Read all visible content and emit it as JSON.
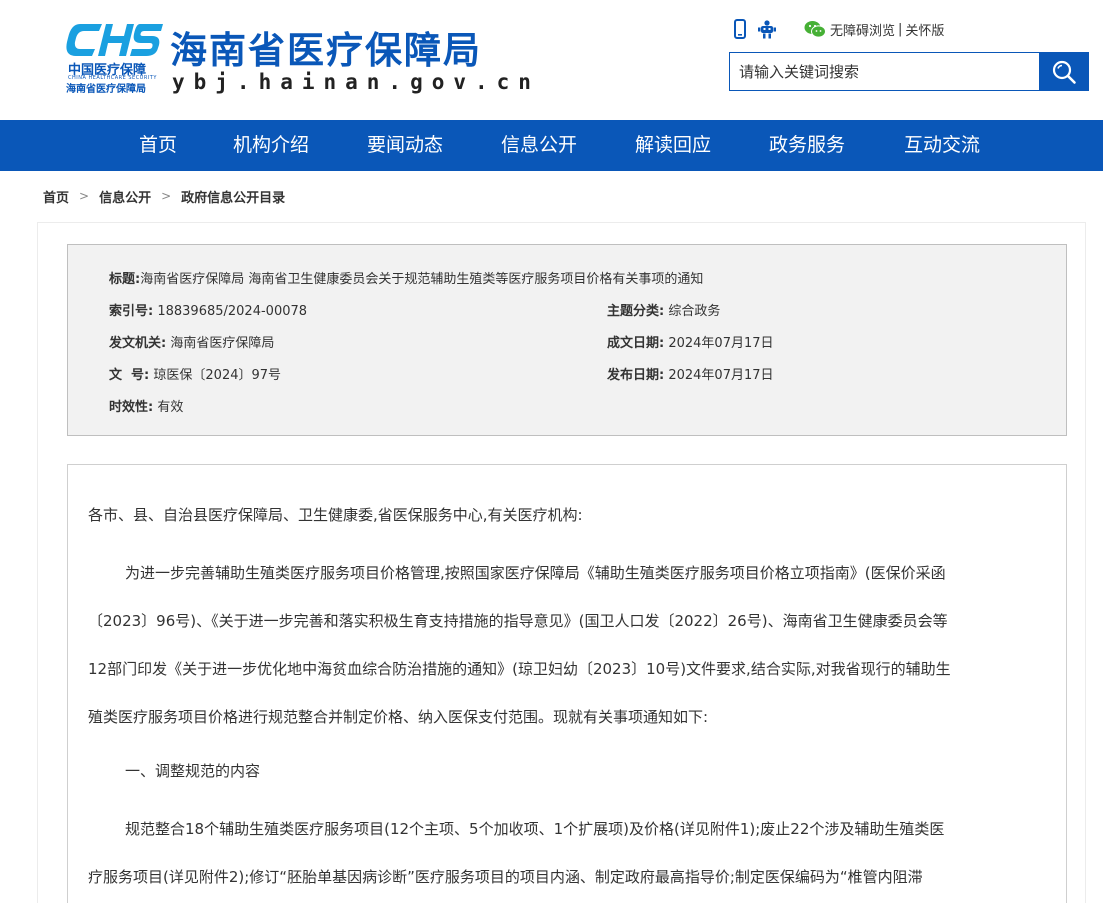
{
  "site": {
    "logo_abbr": "CHS",
    "logo_org_cn": "中国医疗保障",
    "logo_org_en": "CHINA HEALTHCARE SECURITY",
    "logo_org_local": "海南省医疗保障局",
    "title": "海南省医疗保障局",
    "domain": "ybj.hainan.gov.cn"
  },
  "topbar": {
    "accessible": "无障碍浏览",
    "separator": "|",
    "care_mode": "关怀版"
  },
  "search": {
    "placeholder": "请输入关键词搜索"
  },
  "nav": {
    "items": [
      "首页",
      "机构介绍",
      "要闻动态",
      "信息公开",
      "解读回应",
      "政务服务",
      "互动交流"
    ]
  },
  "breadcrumb": {
    "items": [
      "首页",
      "信息公开",
      "政府信息公开目录"
    ],
    "separator": ">"
  },
  "info": {
    "title_label": "标题:",
    "title_value": "海南省医疗保障局 海南省卫生健康委员会关于规范辅助生殖类等医疗服务项目价格有关事项的通知",
    "index_label": "索引号:",
    "index_value": "18839685/2024-00078",
    "topic_label": "主题分类:",
    "topic_value": "综合政务",
    "issuer_label": "发文机关:",
    "issuer_value": "海南省医疗保障局",
    "created_label": "成文日期:",
    "created_value": "2024年07月17日",
    "docno_label": "文  号:",
    "docno_value": "琼医保〔2024〕97号",
    "published_label": "发布日期:",
    "published_value": "2024年07月17日",
    "validity_label": "时效性:",
    "validity_value": "有效"
  },
  "article": {
    "salutation": "各市、县、自治县医疗保障局、卫生健康委,省医保服务中心,有关医疗机构:",
    "p1_lines": [
      "为进一步完善辅助生殖类医疗服务项目价格管理,按照国家医疗保障局《辅助生殖类医疗服务项目价格立项指南》(医保价采函",
      "〔2023〕96号)、《关于进一步完善和落实积极生育支持措施的指导意见》(国卫人口发〔2022〕26号)、海南省卫生健康委员会等",
      "12部门印发《关于进一步优化地中海贫血综合防治措施的通知》(琼卫妇幼〔2023〕10号)文件要求,结合实际,对我省现行的辅助生",
      "殖类医疗服务项目价格进行规范整合并制定价格、纳入医保支付范围。现就有关事项通知如下:"
    ],
    "h1": "一、调整规范的内容",
    "p2_lines": [
      "规范整合18个辅助生殖类医疗服务项目(12个主项、5个加收项、1个扩展项)及价格(详见附件1);废止22个涉及辅助生殖类医",
      "疗服务项目(详见附件2);修订“胚胎单基因病诊断”医疗服务项目的项目内涵、制定政府最高指导价;制定医保编码为“椎管内阻滞"
    ]
  }
}
